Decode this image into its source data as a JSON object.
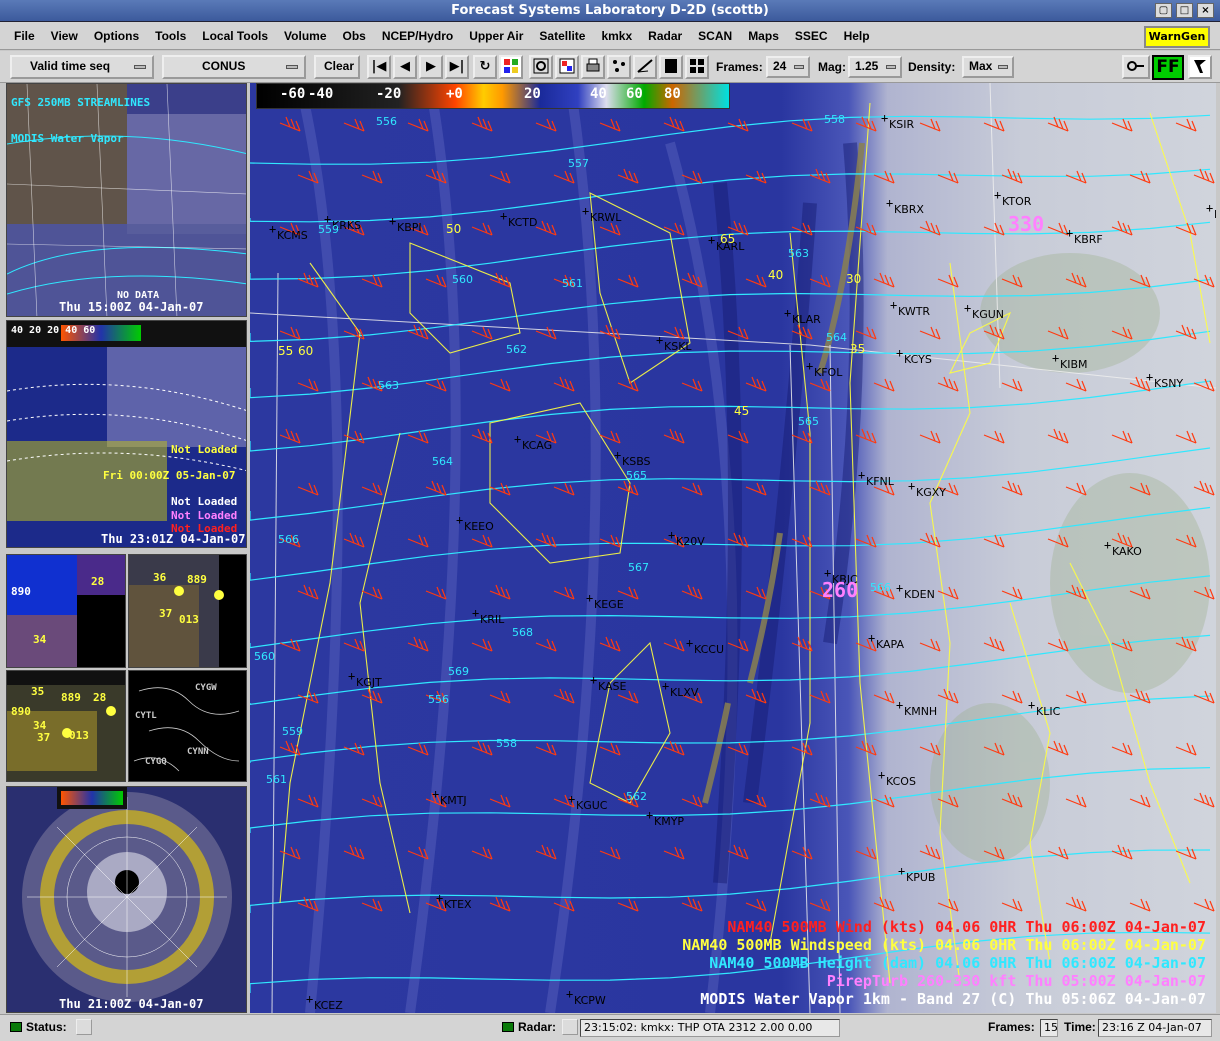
{
  "window": {
    "title": "Forecast Systems Laboratory D-2D (scottb)",
    "buttons": [
      "▢",
      "□",
      "×"
    ]
  },
  "menubar": {
    "items": [
      "File",
      "View",
      "Options",
      "Tools",
      "Local Tools",
      "Volume",
      "Obs",
      "NCEP/Hydro",
      "Upper Air",
      "Satellite",
      "kmkx",
      "Radar",
      "SCAN",
      "Maps",
      "SSEC",
      "Help"
    ],
    "warngen": "WarnGen"
  },
  "toolbar": {
    "loop_mode": "Valid time seq",
    "scale": "CONUS",
    "clear": "Clear",
    "frames_label": "Frames:",
    "frames_value": "24",
    "mag_label": "Mag:",
    "mag_value": "1.25",
    "density_label": "Density:",
    "density_value": "Max",
    "ff_label": "FF",
    "nav_icons": [
      "|◀",
      "◀",
      "▶",
      "▶|",
      "↻"
    ]
  },
  "panels": {
    "p1": {
      "time": "Thu 15:00Z 04-Jan-07",
      "overlay_lines": [
        "GFS 250MB STREAMLINES",
        "MODIS Water Vapor"
      ],
      "nodata": "NO DATA"
    },
    "p2": {
      "colorbar": "40 20 20 40 60",
      "time": "Thu 23:01Z 04-Jan-07",
      "status_lines": [
        "Fri 00:00Z 05-Jan-07",
        "Not Loaded",
        "Not Loaded",
        "Not Loaded",
        "Not Loaded"
      ]
    },
    "p3a": {
      "labels": [
        "890",
        "28",
        "34"
      ]
    },
    "p3b": {
      "labels": [
        "36",
        "889",
        "37",
        "013"
      ]
    },
    "p4a": {
      "labels": [
        "35",
        "889",
        "28",
        "890",
        "34",
        "37",
        "013"
      ]
    },
    "p4b": {
      "labels": [
        "CYGW",
        "CYTL",
        "CYGQ",
        "CYNN"
      ]
    },
    "p5": {
      "time": "Thu 21:00Z 04-Jan-07"
    }
  },
  "main": {
    "colorbar_labels": [
      "-60",
      "-40",
      "-20",
      "+0",
      "20",
      "40",
      "60",
      "80"
    ],
    "stations": [
      {
        "id": "KSIR"
      },
      {
        "id": "KTOR"
      },
      {
        "id": "KAIA"
      },
      {
        "id": "KBRX"
      },
      {
        "id": "KRWL"
      },
      {
        "id": "KCTD"
      },
      {
        "id": "KRKS"
      },
      {
        "id": "KBPI"
      },
      {
        "id": "KCMS"
      },
      {
        "id": "KARL"
      },
      {
        "id": "KGUN"
      },
      {
        "id": "KWTR"
      },
      {
        "id": "KLAR"
      },
      {
        "id": "KCYS"
      },
      {
        "id": "KIBM"
      },
      {
        "id": "KSNY"
      },
      {
        "id": "KSKL"
      },
      {
        "id": "KFOL"
      },
      {
        "id": "KCAG"
      },
      {
        "id": "KSBS"
      },
      {
        "id": "KFNL"
      },
      {
        "id": "KGXY"
      },
      {
        "id": "KEEO"
      },
      {
        "id": "K20V"
      },
      {
        "id": "KAKO"
      },
      {
        "id": "KBJC"
      },
      {
        "id": "KDEN"
      },
      {
        "id": "KRIL"
      },
      {
        "id": "KEGE"
      },
      {
        "id": "KAPA"
      },
      {
        "id": "KCCU"
      },
      {
        "id": "KGJT"
      },
      {
        "id": "KASE"
      },
      {
        "id": "KLXV"
      },
      {
        "id": "KMNH"
      },
      {
        "id": "KLIC"
      },
      {
        "id": "KCOS"
      },
      {
        "id": "KMTJ"
      },
      {
        "id": "KGUC"
      },
      {
        "id": "KMYP"
      },
      {
        "id": "KPUB"
      },
      {
        "id": "KTEX"
      },
      {
        "id": "KCEZ"
      },
      {
        "id": "KCPW"
      },
      {
        "id": "KBRF"
      }
    ],
    "height_labels": [
      "556",
      "557",
      "558",
      "559",
      "560",
      "561",
      "562",
      "563",
      "564",
      "565",
      "566",
      "567",
      "568",
      "569",
      "556",
      "558",
      "559",
      "560",
      "561",
      "562",
      "563",
      "564",
      "565",
      "566"
    ],
    "speed_labels": [
      "50",
      "55",
      "60",
      "65",
      "45",
      "40",
      "35",
      "30"
    ],
    "big_labels": [
      "330",
      "260"
    ],
    "legend": [
      {
        "text": "NAM40 500MB Wind (kts)  04.06  0HR Thu 06:00Z 04-Jan-07",
        "color": "#ff2020"
      },
      {
        "text": "NAM40 500MB Windspeed (kts)  04.06  0HR Thu 06:00Z 04-Jan-07",
        "color": "#ffff40"
      },
      {
        "text": "NAM40 500MB Height (dam)  04.06  0HR Thu 06:00Z 04-Jan-07",
        "color": "#30e8ff"
      },
      {
        "text": "PirepTurb 260-330 kft  Thu 05:00Z 04-Jan-07",
        "color": "#ff80ff"
      },
      {
        "text": "MODIS Water Vapor 1km - Band 27 (C)  Thu 05:06Z 04-Jan-07",
        "color": "#ffffff"
      }
    ]
  },
  "statusbar": {
    "status_label": "Status:",
    "radar_label": "Radar:",
    "radar_info": "23:15:02: kmkx: THP  OTA 2312  2.00  0.00",
    "frames_label": "Frames:",
    "frames_value": "15",
    "time_label": "Time:",
    "time_value": "23:16 Z 04-Jan-07"
  },
  "colors": {
    "wind_barb": "#ff3a10",
    "windspeed": "#ffff40",
    "height": "#30e8ff",
    "warngen_bg": "#ffff00",
    "ff_bg": "#00cc00"
  }
}
